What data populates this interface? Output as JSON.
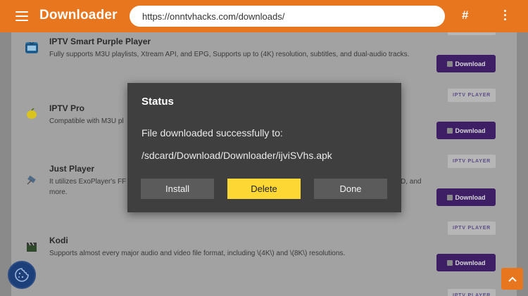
{
  "appbar": {
    "title": "Downloader",
    "url": "https://onntvhacks.com/downloads/",
    "hash_label": "#"
  },
  "apps": [
    {
      "name": "IPTV Smart Purple Player",
      "description": "Fully supports M3U playlists, Xtream API, and EPG, Supports up to (4K) resolution, subtitles, and dual-audio tracks.",
      "download_label": "Download",
      "tag": "",
      "icon": "tv-icon"
    },
    {
      "name": "IPTV Pro",
      "description": "Compatible with M3U pl",
      "download_label": "Download",
      "tag": "IPTV PLAYER",
      "icon": "lemon-icon"
    },
    {
      "name": "Just Player",
      "description_line1": "It utilizes ExoPlayer's FF",
      "description_line1_tail": "D, and",
      "description_line2": "more.",
      "download_label": "Download",
      "tag": "IPTV PLAYER",
      "icon": "satellite-icon"
    },
    {
      "name": "Kodi",
      "description": "Supports almost every major audio and video file format, including \\(4K\\) and \\(8K\\) resolutions.",
      "download_label": "Download",
      "tag": "IPTV PLAYER",
      "icon": "clapperboard-icon"
    }
  ],
  "partial_tag_bottom": "IPTV PLAYER",
  "dialog": {
    "title": "Status",
    "message": "File downloaded successfully to:",
    "path": "/sdcard/Download/Downloader/ijviSVhs.apk",
    "install_label": "Install",
    "delete_label": "Delete",
    "done_label": "Done"
  },
  "colors": {
    "accent": "#e8761f",
    "download_button": "#3e1f66",
    "dialog_bg": "#3f3f3f",
    "delete_button": "#fdd835"
  }
}
